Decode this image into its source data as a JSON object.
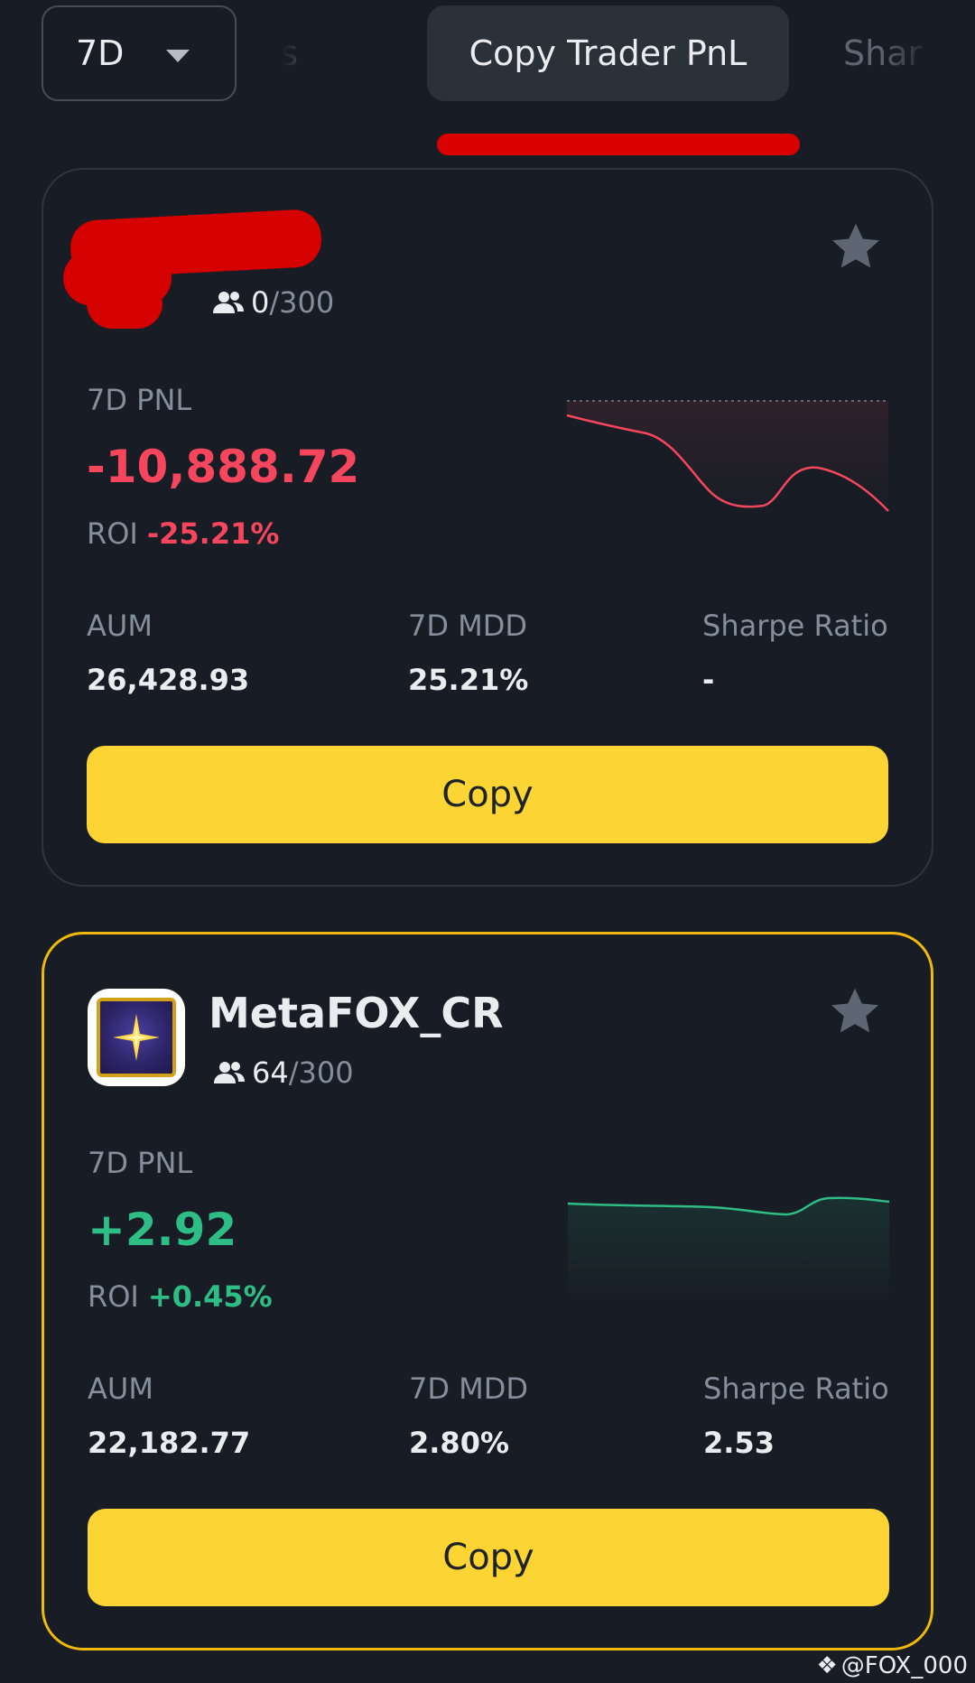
{
  "filter": {
    "period": "7D",
    "tabs": [
      "aders",
      "Copy Trader PnL",
      "Shar"
    ]
  },
  "cards": [
    {
      "nickname": "",
      "followers_current": "0",
      "followers_max": "/300",
      "pnl_label": "7D PNL",
      "pnl_value": "-10,888.72",
      "roi_label": "ROI",
      "roi_value": "-25.21%",
      "aum_label": "AUM",
      "aum_value": "26,428.93",
      "mdd_label": "7D MDD",
      "mdd_value": "25.21%",
      "sharpe_label": "Sharpe Ratio",
      "sharpe_value": "-",
      "copy_label": "Copy",
      "trend": "down"
    },
    {
      "nickname": "MetaFOX_CR",
      "followers_current": "64",
      "followers_max": "/300",
      "pnl_label": "7D PNL",
      "pnl_value": "+2.92",
      "roi_label": "ROI",
      "roi_value": "+0.45%",
      "aum_label": "AUM",
      "aum_value": "22,182.77",
      "mdd_label": "7D MDD",
      "mdd_value": "2.80%",
      "sharpe_label": "Sharpe Ratio",
      "sharpe_value": "2.53",
      "copy_label": "Copy",
      "trend": "up"
    }
  ],
  "watermark": "@FOX_000",
  "colors": {
    "background": "#181d25",
    "accent_yellow": "#fcd535",
    "highlight_border": "#f0b90b",
    "negative": "#f6465d",
    "positive": "#2ebd85",
    "muted": "#848e9c"
  },
  "icons": [
    "chevron-down-icon",
    "users-icon",
    "star-icon",
    "binance-logo-icon"
  ]
}
